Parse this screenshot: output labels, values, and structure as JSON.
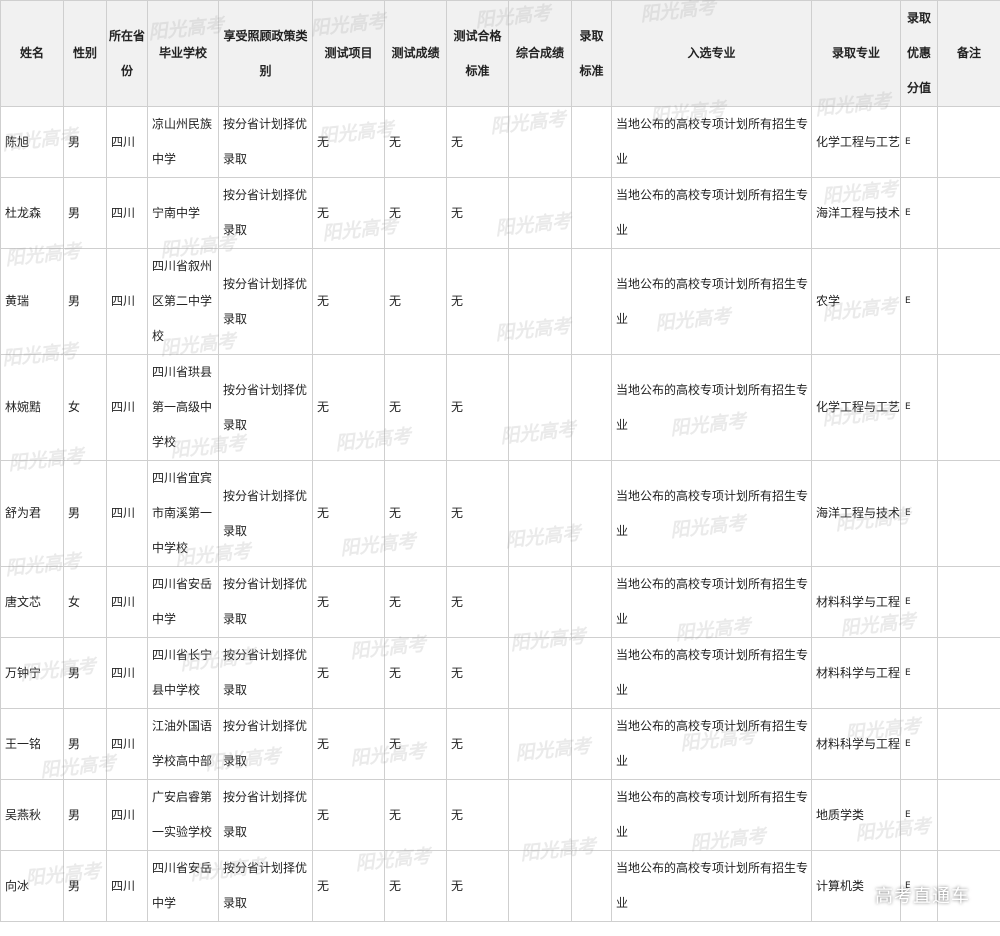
{
  "headers": [
    "姓名",
    "性别",
    "所在省份",
    "毕业学校",
    "享受照顾政策类别",
    "测试项目",
    "测试成绩",
    "测试合格标准",
    "综合成绩",
    "录取标准",
    "入选专业",
    "录取专业",
    "录取优惠分值",
    "备注"
  ],
  "rows": [
    [
      "陈旭",
      "男",
      "四川",
      "凉山州民族中学",
      "按分省计划择优录取",
      "无",
      "无",
      "无",
      "",
      "",
      "当地公布的高校专项计划所有招生专业",
      "化学工程与工艺",
      "E",
      ""
    ],
    [
      "杜龙森",
      "男",
      "四川",
      "宁南中学",
      "按分省计划择优录取",
      "无",
      "无",
      "无",
      "",
      "",
      "当地公布的高校专项计划所有招生专业",
      "海洋工程与技术",
      "E",
      ""
    ],
    [
      "黄瑞",
      "男",
      "四川",
      "四川省叙州区第二中学校",
      "按分省计划择优录取",
      "无",
      "无",
      "无",
      "",
      "",
      "当地公布的高校专项计划所有招生专业",
      "农学",
      "E",
      ""
    ],
    [
      "林婉黠",
      "女",
      "四川",
      "四川省珙县第一高级中学校",
      "按分省计划择优录取",
      "无",
      "无",
      "无",
      "",
      "",
      "当地公布的高校专项计划所有招生专业",
      "化学工程与工艺",
      "E",
      ""
    ],
    [
      "舒为君",
      "男",
      "四川",
      "四川省宜宾市南溪第一中学校",
      "按分省计划择优录取",
      "无",
      "无",
      "无",
      "",
      "",
      "当地公布的高校专项计划所有招生专业",
      "海洋工程与技术",
      "E",
      ""
    ],
    [
      "唐文芯",
      "女",
      "四川",
      "四川省安岳中学",
      "按分省计划择优录取",
      "无",
      "无",
      "无",
      "",
      "",
      "当地公布的高校专项计划所有招生专业",
      "材料科学与工程",
      "E",
      ""
    ],
    [
      "万钟宁",
      "男",
      "四川",
      "四川省长宁县中学校",
      "按分省计划择优录取",
      "无",
      "无",
      "无",
      "",
      "",
      "当地公布的高校专项计划所有招生专业",
      "材料科学与工程",
      "E",
      ""
    ],
    [
      "王一铭",
      "男",
      "四川",
      "江油外国语学校高中部",
      "按分省计划择优录取",
      "无",
      "无",
      "无",
      "",
      "",
      "当地公布的高校专项计划所有招生专业",
      "材料科学与工程",
      "E",
      ""
    ],
    [
      "吴燕秋",
      "男",
      "四川",
      "广安启睿第一实验学校",
      "按分省计划择优录取",
      "无",
      "无",
      "无",
      "",
      "",
      "当地公布的高校专项计划所有招生专业",
      "地质学类",
      "E",
      ""
    ],
    [
      "向冰",
      "男",
      "四川",
      "四川省安岳中学",
      "按分省计划择优录取",
      "无",
      "无",
      "无",
      "",
      "",
      "当地公布的高校专项计划所有招生专业",
      "计算机类",
      "E",
      ""
    ]
  ],
  "watermark": "阳光高考",
  "brand": "高考直通车"
}
